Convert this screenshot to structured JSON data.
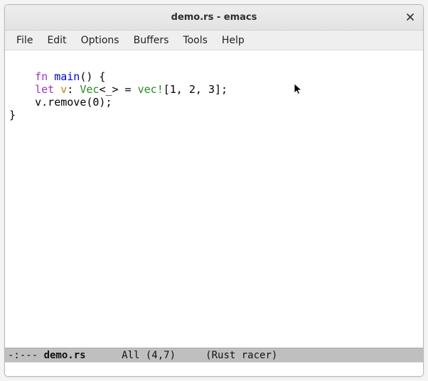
{
  "window": {
    "title": "demo.rs - emacs"
  },
  "menubar": {
    "items": [
      "File",
      "Edit",
      "Options",
      "Buffers",
      "Tools",
      "Help"
    ]
  },
  "code": {
    "tokens": [
      {
        "t": "fn ",
        "cls": "kw"
      },
      {
        "t": "main",
        "cls": "fnname"
      },
      {
        "t": "() {\n",
        "cls": ""
      },
      {
        "t": "    ",
        "cls": ""
      },
      {
        "t": "let ",
        "cls": "kw"
      },
      {
        "t": "v",
        "cls": "var"
      },
      {
        "t": ": ",
        "cls": ""
      },
      {
        "t": "Vec",
        "cls": "ty"
      },
      {
        "t": "<_> = ",
        "cls": ""
      },
      {
        "t": "vec!",
        "cls": "builtin"
      },
      {
        "t": "[1, 2, 3];\n",
        "cls": ""
      },
      {
        "t": "    v.remove(0);\n",
        "cls": ""
      },
      {
        "t": "}\n",
        "cls": ""
      }
    ]
  },
  "modeline": {
    "left": "-:--- ",
    "buffer": "demo.rs",
    "mid": "      All (4,7)     ",
    "mode": "(Rust racer)"
  }
}
